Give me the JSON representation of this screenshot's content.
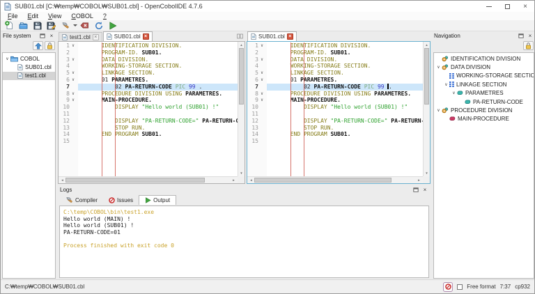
{
  "window": {
    "title": "SUB01.cbl [C:₩temp₩COBOL₩SUB01.cbl] - OpenCobolIDE 4.7.6",
    "controls": [
      "minimize",
      "maximize",
      "close"
    ]
  },
  "menu": {
    "items": [
      {
        "label": "File"
      },
      {
        "label": "Edit"
      },
      {
        "label": "View"
      },
      {
        "label": "COBOL"
      },
      {
        "label": "?"
      }
    ]
  },
  "toolbar": {
    "buttons": [
      {
        "icon": "new-file",
        "name": "new-file-button"
      },
      {
        "icon": "open",
        "name": "open-file-button"
      },
      {
        "icon": "save",
        "name": "save-button"
      },
      {
        "icon": "save-as",
        "name": "save-as-button"
      },
      {
        "icon": "compile",
        "name": "compile-button",
        "dropdown": true
      },
      {
        "icon": "cancel",
        "name": "cancel-button"
      },
      {
        "icon": "rebuild",
        "name": "rebuild-button"
      },
      {
        "icon": "run",
        "name": "run-button"
      }
    ]
  },
  "file_system": {
    "title": "File system",
    "toolbar_icons": [
      "arrow-up",
      "lock"
    ],
    "tree": [
      {
        "label": "COBOL",
        "icon": "folder",
        "indent": 0,
        "expander": true,
        "selected": false
      },
      {
        "label": "SUB01.cbl",
        "icon": "file",
        "indent": 1,
        "expander": false,
        "selected": false
      },
      {
        "label": "test1.cbl",
        "icon": "file",
        "indent": 1,
        "expander": false,
        "selected": true
      }
    ]
  },
  "editors": {
    "code": {
      "lines": [
        {
          "n": 1,
          "fold": true,
          "tokens": [
            [
              "       ",
              "d"
            ],
            [
              "IDENTIFICATION DIVISION.",
              "k"
            ]
          ]
        },
        {
          "n": 2,
          "fold": false,
          "tokens": [
            [
              "       ",
              "d"
            ],
            [
              "PROGRAM-ID.",
              "k"
            ],
            [
              " ",
              "d"
            ],
            [
              "SUB01.",
              "i"
            ]
          ]
        },
        {
          "n": 3,
          "fold": true,
          "tokens": [
            [
              "       ",
              "d"
            ],
            [
              "DATA DIVISION.",
              "k"
            ]
          ]
        },
        {
          "n": 4,
          "fold": false,
          "tokens": [
            [
              "       ",
              "d"
            ],
            [
              "WORKING-STORAGE SECTION.",
              "k"
            ]
          ]
        },
        {
          "n": 5,
          "fold": true,
          "tokens": [
            [
              "       ",
              "d"
            ],
            [
              "LINKAGE SECTION.",
              "k"
            ]
          ]
        },
        {
          "n": 6,
          "fold": true,
          "tokens": [
            [
              "       ",
              "d"
            ],
            [
              "01 ",
              "d"
            ],
            [
              "PARAMETRES.",
              "i"
            ]
          ]
        },
        {
          "n": 7,
          "fold": false,
          "active": true,
          "tokens": [
            [
              "           ",
              "d"
            ],
            [
              "02 ",
              "d"
            ],
            [
              "PA-RETURN-CODE ",
              "i"
            ],
            [
              "PIC",
              "p"
            ],
            [
              " ",
              "d"
            ],
            [
              "99",
              "n"
            ],
            [
              " ",
              "d"
            ],
            [
              ".",
              "d"
            ]
          ]
        },
        {
          "n": 8,
          "fold": true,
          "tokens": [
            [
              "       ",
              "d"
            ],
            [
              "PROCEDURE DIVISION USING ",
              "k"
            ],
            [
              "PARAMETRES.",
              "i"
            ]
          ]
        },
        {
          "n": 9,
          "fold": true,
          "tokens": [
            [
              "       ",
              "d"
            ],
            [
              "MAIN-PROCEDURE.",
              "i"
            ]
          ]
        },
        {
          "n": 10,
          "fold": false,
          "tokens": [
            [
              "           ",
              "d"
            ],
            [
              "DISPLAY",
              "k"
            ],
            [
              " ",
              "d"
            ],
            [
              "\"Hello world (SUB01) !\"",
              "s"
            ]
          ]
        },
        {
          "n": 11,
          "fold": false,
          "tokens": []
        },
        {
          "n": 12,
          "fold": false,
          "tokens": [
            [
              "           ",
              "d"
            ],
            [
              "DISPLAY",
              "k"
            ],
            [
              " ",
              "d"
            ],
            [
              "\"PA-RETURN-CODE=\"",
              "s"
            ],
            [
              " ",
              "d"
            ],
            [
              "PA-RETURN-CODE.",
              "i"
            ]
          ]
        },
        {
          "n": 13,
          "fold": false,
          "tokens": [
            [
              "           ",
              "d"
            ],
            [
              "STOP RUN.",
              "k"
            ]
          ]
        },
        {
          "n": 14,
          "fold": false,
          "tokens": [
            [
              "       ",
              "d"
            ],
            [
              "END PROGRAM ",
              "k"
            ],
            [
              "SUB01.",
              "i"
            ]
          ]
        },
        {
          "n": 15,
          "fold": false,
          "tokens": []
        }
      ]
    },
    "groups": [
      {
        "id": "left",
        "tabs": [
          {
            "label": "test1.cbl",
            "active": false,
            "close": "plain"
          },
          {
            "label": "SUB01.cbl",
            "active": true,
            "close": "red"
          }
        ],
        "split_button": true,
        "focused": false
      },
      {
        "id": "right",
        "tabs": [
          {
            "label": "SUB01.cbl",
            "active": true,
            "close": "red"
          }
        ],
        "split_button": false,
        "focused": true,
        "cursor": {
          "line": 7,
          "before_token": 7
        }
      }
    ]
  },
  "navigation": {
    "title": "Navigation",
    "toolbar_icons": [
      "lock"
    ],
    "tree": [
      {
        "label": "IDENTIFICATION DIVISION",
        "icon": "division",
        "indent": 0,
        "expander": false
      },
      {
        "label": "DATA DIVISION",
        "icon": "division",
        "indent": 0,
        "expander": true
      },
      {
        "label": "WORKING-STORAGE SECTION",
        "icon": "section",
        "indent": 1,
        "expander": false
      },
      {
        "label": "LINKAGE SECTION",
        "icon": "section",
        "indent": 1,
        "expander": true
      },
      {
        "label": "PARAMETRES",
        "icon": "variable",
        "indent": 2,
        "expander": true
      },
      {
        "label": "PA-RETURN-CODE",
        "icon": "variable",
        "indent": 3,
        "expander": false
      },
      {
        "label": "PROCEDURE DIVISION",
        "icon": "division",
        "indent": 0,
        "expander": true
      },
      {
        "label": "MAIN-PROCEDURE",
        "icon": "procedure",
        "indent": 1,
        "expander": false
      }
    ]
  },
  "logs": {
    "title": "Logs",
    "tabs": [
      {
        "label": "Compiler",
        "icon": "hammer",
        "active": false
      },
      {
        "label": "Issues",
        "icon": "issues",
        "active": false
      },
      {
        "label": "Output",
        "icon": "run",
        "active": true
      }
    ],
    "output": [
      {
        "text": "C:\\temp\\COBOL\\bin\\test1.exe",
        "cls": "path"
      },
      {
        "text": "Hello world (MAIN) !",
        "cls": "plain"
      },
      {
        "text": "Hello world (SUB01) !",
        "cls": "plain"
      },
      {
        "text": "PA-RETURN-CODE=01",
        "cls": "plain"
      },
      {
        "text": "",
        "cls": "plain"
      },
      {
        "text": "Process finished with exit code 0",
        "cls": "info"
      }
    ]
  },
  "status_bar": {
    "path": "C:₩temp₩COBOL₩SUB01.cbl",
    "free_format_label": "Free format",
    "free_format_checked": false,
    "position": "7:37",
    "encoding": "cp932"
  },
  "colors": {
    "keyword": "#847b16",
    "identifier": "#111111",
    "string": "#2ca02c",
    "number": "#3a3ac8",
    "pic_clause": "#7ca87c",
    "active_line": "#cde6fa",
    "margin_line": "#cc5046",
    "output_info": "#c9a22a",
    "selection": "#d4d4d4",
    "focus_border": "#68b0cf",
    "run_green": "#41a53f",
    "error_red": "#c92a2a"
  }
}
